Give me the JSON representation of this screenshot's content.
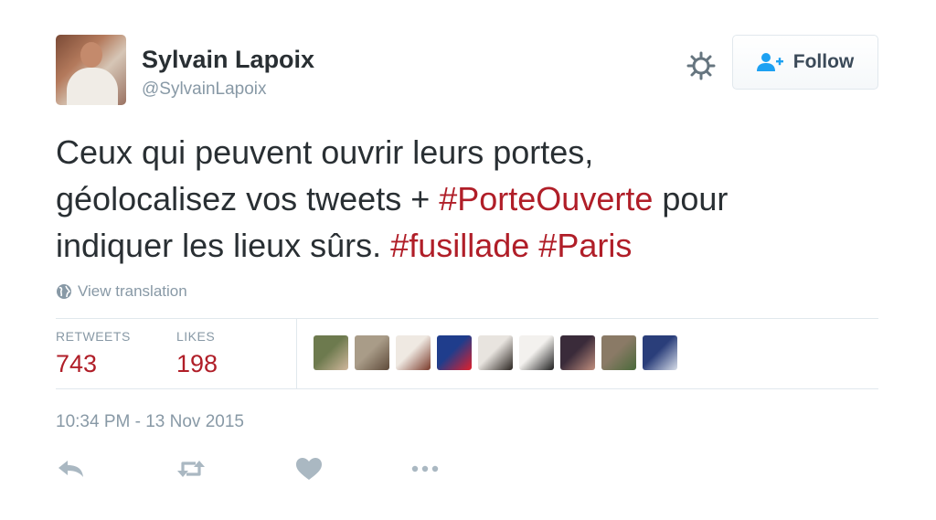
{
  "user": {
    "display_name": "Sylvain Lapoix",
    "screen_name": "@SylvainLapoix"
  },
  "header": {
    "gear_icon": "gear-icon",
    "follow_label": "Follow",
    "follow_icon": "add-user-icon"
  },
  "tweet": {
    "segments": [
      {
        "text": "Ceux qui peuvent ouvrir leurs portes,",
        "type": "text"
      },
      {
        "text": "géolocalisez vos tweets + ",
        "type": "text"
      },
      {
        "text": "#PorteOuverte",
        "type": "hashtag"
      },
      {
        "text": " pour",
        "type": "text"
      },
      {
        "text": "indiquer les lieux sûrs. ",
        "type": "text"
      },
      {
        "text": "#fusillade",
        "type": "hashtag"
      },
      {
        "text": " ",
        "type": "text"
      },
      {
        "text": "#Paris",
        "type": "hashtag"
      }
    ],
    "hashtag_color": "#b01e28"
  },
  "translate": {
    "label": "View translation",
    "icon": "globe-icon"
  },
  "stats": {
    "retweets_label": "RETWEETS",
    "retweets_value": "743",
    "likes_label": "LIKES",
    "likes_value": "198"
  },
  "likers": [
    {
      "name": "liker-avatar-1",
      "color_a": "#6d7a4e",
      "color_b": "#d0b79c"
    },
    {
      "name": "liker-avatar-2",
      "color_a": "#a99c88",
      "color_b": "#5e4a3a"
    },
    {
      "name": "liker-avatar-3",
      "color_a": "#efe9e2",
      "color_b": "#7a3a2a"
    },
    {
      "name": "liker-avatar-4",
      "color_a": "#1f3d8c",
      "color_b": "#e11f2b"
    },
    {
      "name": "liker-avatar-5",
      "color_a": "#e8e4df",
      "color_b": "#2a2420"
    },
    {
      "name": "liker-avatar-6",
      "color_a": "#f3f1ee",
      "color_b": "#1e1e1e"
    },
    {
      "name": "liker-avatar-7",
      "color_a": "#3a2b3a",
      "color_b": "#c08e7e"
    },
    {
      "name": "liker-avatar-8",
      "color_a": "#8a7a66",
      "color_b": "#4a6a3a"
    },
    {
      "name": "liker-avatar-9",
      "color_a": "#2a3e7a",
      "color_b": "#d7dde8"
    }
  ],
  "timestamp": "10:34 PM - 13 Nov 2015",
  "actions": [
    {
      "name": "reply-icon"
    },
    {
      "name": "retweet-icon"
    },
    {
      "name": "like-heart-icon"
    },
    {
      "name": "more-options-icon"
    }
  ],
  "colors": {
    "accent": "#b01e28",
    "muted": "#8899a6",
    "border": "#e1e8ed",
    "text": "#292f33"
  }
}
